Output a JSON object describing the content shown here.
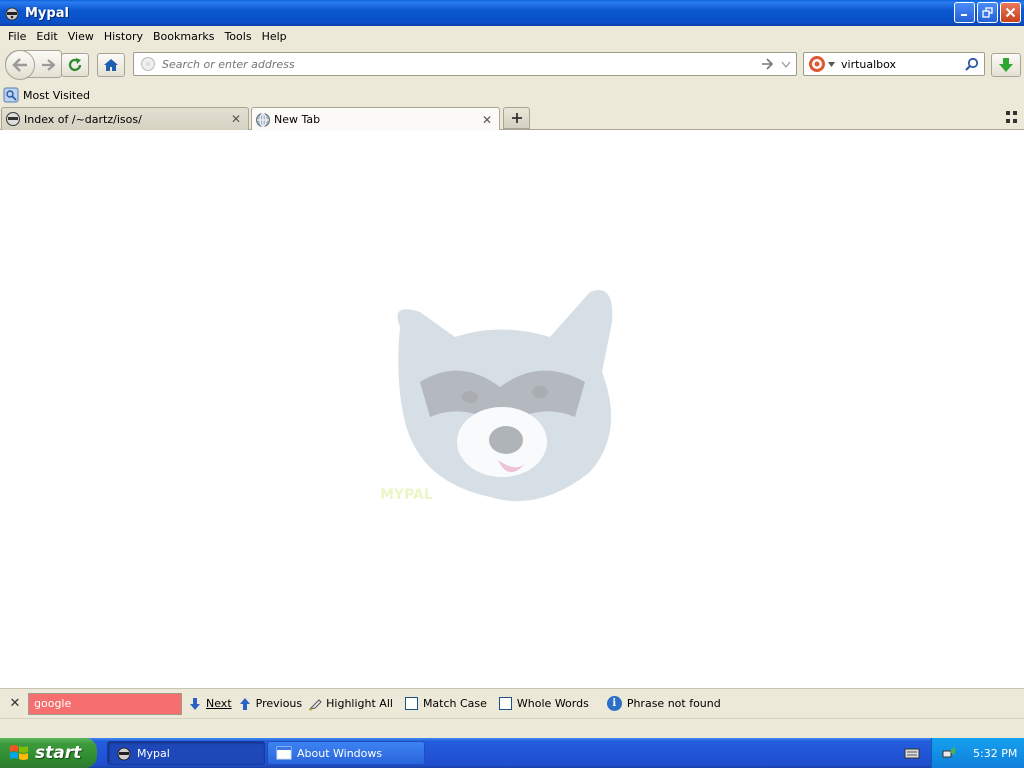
{
  "window": {
    "title": "Mypal",
    "icon": "raccoon-app-icon"
  },
  "menu": [
    "File",
    "Edit",
    "View",
    "History",
    "Bookmarks",
    "Tools",
    "Help"
  ],
  "navbar": {
    "address_placeholder": "Search or enter address",
    "search_value": "virtualbox"
  },
  "bookmarks": {
    "most_visited": "Most Visited"
  },
  "tabs": [
    {
      "label": "Index of /~dartz/isos/",
      "active": false,
      "icon": "site-icon"
    },
    {
      "label": "New Tab",
      "active": true,
      "icon": "globe-icon"
    }
  ],
  "content": {
    "logo_text": "MYPAL"
  },
  "findbar": {
    "query": "google",
    "next": "Next",
    "previous": "Previous",
    "highlight_all": "Highlight All",
    "match_case": "Match Case",
    "whole_words": "Whole Words",
    "status": "Phrase not found",
    "input_color": "#f66f6f"
  },
  "taskbar": {
    "start": "start",
    "tasks": [
      "Mypal",
      "About Windows"
    ],
    "clock": "5:32 PM"
  }
}
